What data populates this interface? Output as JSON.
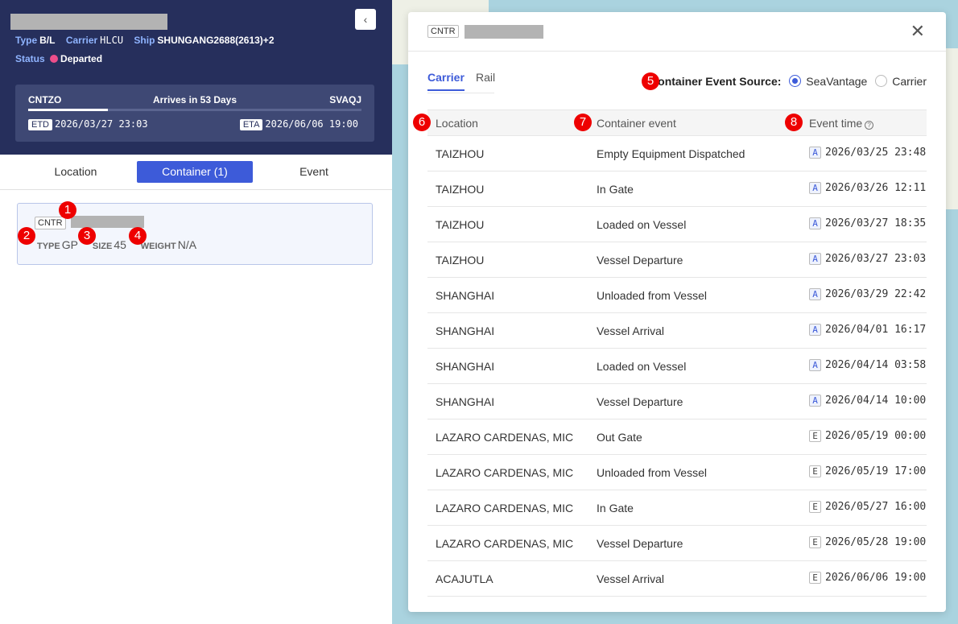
{
  "header": {
    "type_label": "Type",
    "type_value": "B/L",
    "carrier_label": "Carrier",
    "carrier_value": "HLCU",
    "ship_label": "Ship",
    "ship_value": "SHUNGANG2688(2613)+2",
    "status_label": "Status",
    "status_value": "Departed",
    "collapse_icon": "chevron-left-icon"
  },
  "route": {
    "origin": "CNTZO",
    "arrives": "Arrives in 53 Days",
    "destination": "SVAQJ",
    "progress": 0.24,
    "etd_label": "ETD",
    "etd_value": "2026/03/27 23:03",
    "eta_label": "ETA",
    "eta_value": "2026/06/06 19:00"
  },
  "left_tabs": [
    "Location",
    "Container (1)",
    "Event"
  ],
  "container_card": {
    "tag": "CNTR",
    "type_label": "TYPE",
    "type_value": "GP",
    "size_label": "SIZE",
    "size_value": "45",
    "weight_label": "WEIGHT",
    "weight_value": "N/A"
  },
  "badges": [
    "1",
    "2",
    "3",
    "4",
    "5",
    "6",
    "7",
    "8"
  ],
  "modal": {
    "tag": "CNTR",
    "close_icon": "close-icon",
    "tabs": [
      "Carrier",
      "Rail"
    ],
    "source_title": "Container Event Source:",
    "source_options": [
      "SeaVantage",
      "Carrier"
    ],
    "columns": [
      "Location",
      "Container event",
      "Event time"
    ],
    "help_icon": "?",
    "rows": [
      {
        "location": "TAIZHOU",
        "event": "Empty Equipment Dispatched",
        "flag": "A",
        "time": "2026/03/25 23:48"
      },
      {
        "location": "TAIZHOU",
        "event": "In Gate",
        "flag": "A",
        "time": "2026/03/26 12:11"
      },
      {
        "location": "TAIZHOU",
        "event": "Loaded on Vessel",
        "flag": "A",
        "time": "2026/03/27 18:35"
      },
      {
        "location": "TAIZHOU",
        "event": "Vessel Departure",
        "flag": "A",
        "time": "2026/03/27 23:03"
      },
      {
        "location": "SHANGHAI",
        "event": "Unloaded from Vessel",
        "flag": "A",
        "time": "2026/03/29 22:42"
      },
      {
        "location": "SHANGHAI",
        "event": "Vessel Arrival",
        "flag": "A",
        "time": "2026/04/01 16:17"
      },
      {
        "location": "SHANGHAI",
        "event": "Loaded on Vessel",
        "flag": "A",
        "time": "2026/04/14 03:58"
      },
      {
        "location": "SHANGHAI",
        "event": "Vessel Departure",
        "flag": "A",
        "time": "2026/04/14 10:00"
      },
      {
        "location": "LAZARO CARDENAS, MIC",
        "event": "Out Gate",
        "flag": "E",
        "time": "2026/05/19 00:00"
      },
      {
        "location": "LAZARO CARDENAS, MIC",
        "event": "Unloaded from Vessel",
        "flag": "E",
        "time": "2026/05/19 17:00"
      },
      {
        "location": "LAZARO CARDENAS, MIC",
        "event": "In Gate",
        "flag": "E",
        "time": "2026/05/27 16:00"
      },
      {
        "location": "LAZARO CARDENAS, MIC",
        "event": "Vessel Departure",
        "flag": "E",
        "time": "2026/05/28 19:00"
      },
      {
        "location": "ACAJUTLA",
        "event": "Vessel Arrival",
        "flag": "E",
        "time": "2026/06/06 19:00"
      }
    ]
  },
  "colors": {
    "header_bg": "#262f5c",
    "accent": "#3d5bd9",
    "status_dot": "#ec4e8b",
    "badge": "#e00000"
  }
}
